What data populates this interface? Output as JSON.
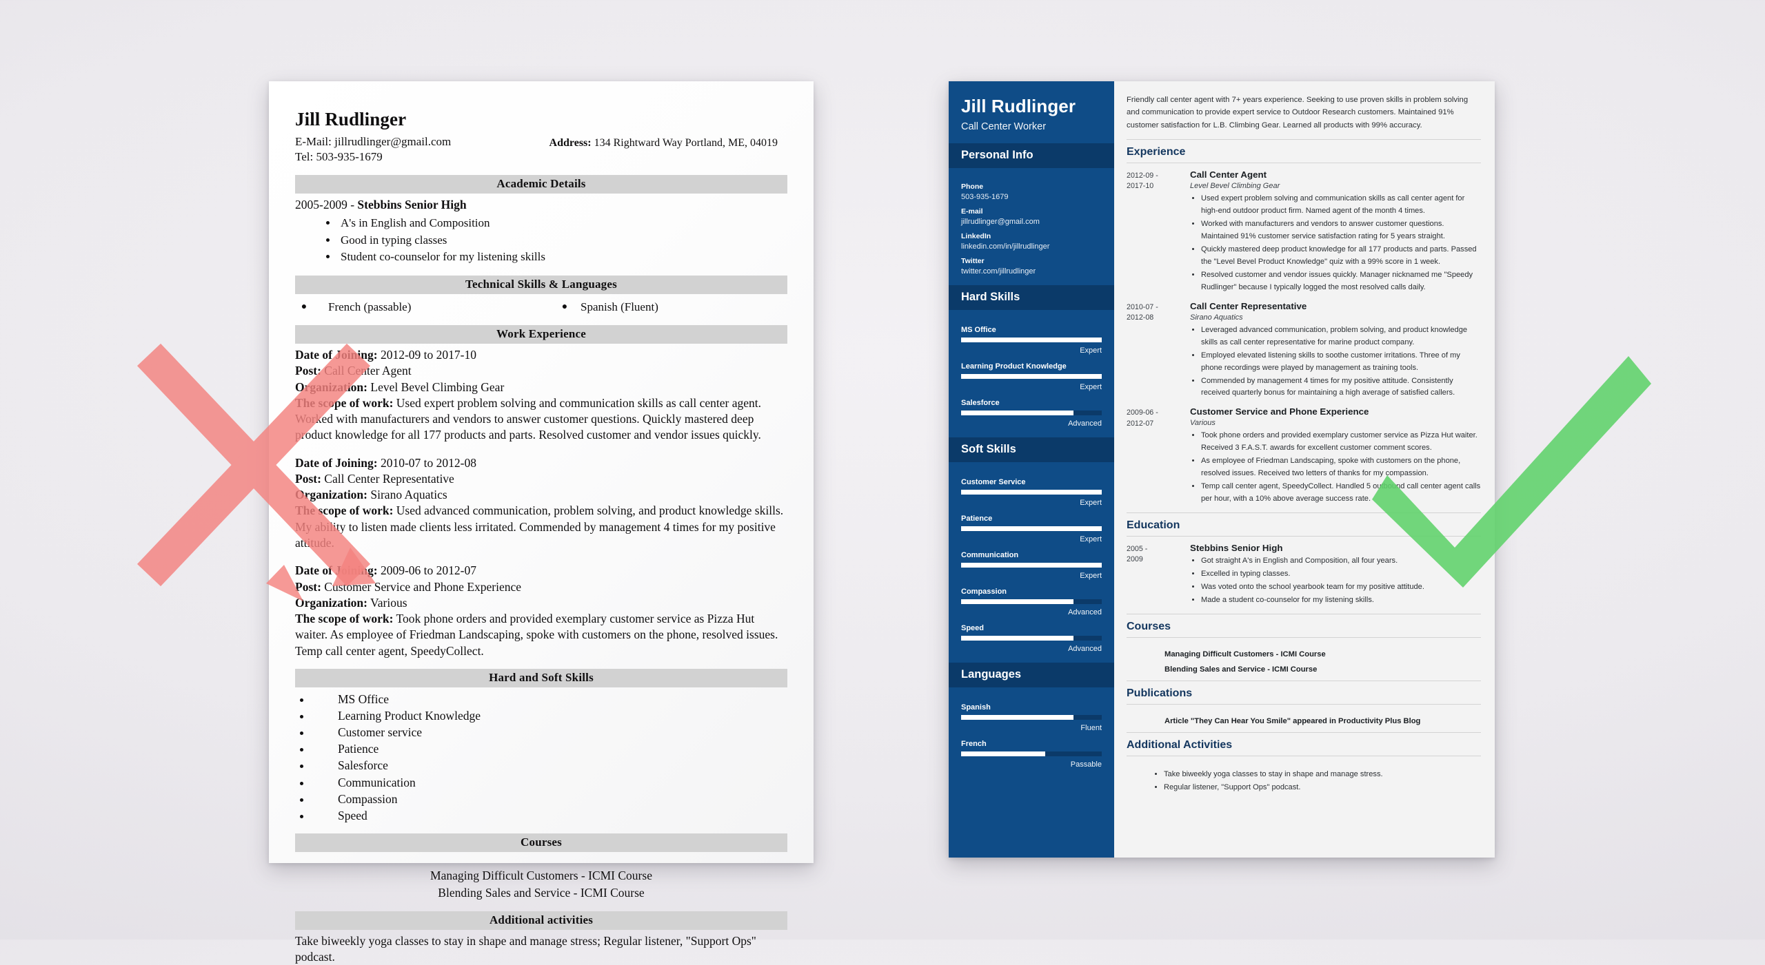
{
  "colors": {
    "sidebar_blue": "#0f4c87",
    "sidebar_blue_dark": "#0b3a69",
    "heading_blue": "#13365e",
    "bad_mark_red": "#f4827f",
    "good_mark_green": "#5ed16a",
    "bad_section_bar": "#d2d2d2"
  },
  "bad_resume": {
    "name": "Jill Rudlinger",
    "email_line": "E-Mail: jillrudlinger@gmail.com",
    "tel_line": "Tel: 503-935-1679",
    "address_label": "Address:",
    "address_value": "134 Rightward Way Portland, ME, 04019",
    "sections": {
      "academic": {
        "title": "Academic Details",
        "school_line_years": "2005-2009 - ",
        "school_line_name": "Stebbins Senior High",
        "bullets": [
          "A's in English and Composition",
          "Good in typing classes",
          "Student co-counselor for my listening skills"
        ]
      },
      "technical": {
        "title": "Technical Skills & Languages",
        "left": "French (passable)",
        "right": "Spanish (Fluent)"
      },
      "work": {
        "title": "Work Experience",
        "jobs": [
          {
            "date_label": "Date of Joining:",
            "date_value": " 2012-09 to 2017-10",
            "post_label": "Post:",
            "post_value": " Call Center Agent",
            "org_label": "Organization:",
            "org_value": " Level Bevel Climbing Gear",
            "scope_label": "The scope of work:",
            "scope_value": " Used expert problem solving and communication skills as call center agent. Worked with manufacturers and vendors to answer customer questions. Quickly mastered deep product knowledge for all 177 products and parts. Resolved customer and vendor issues quickly."
          },
          {
            "date_label": "Date of Joining:",
            "date_value": " 2010-07 to 2012-08",
            "post_label": "Post:",
            "post_value": " Call Center Representative",
            "org_label": "Organization:",
            "org_value": " Sirano Aquatics",
            "scope_label": "The scope of work:",
            "scope_value": " Used advanced communication, problem solving, and product knowledge skills. My ability to listen made clients less irritated. Commended by management 4 times for my positive attitude."
          },
          {
            "date_label": "Date of Joining:",
            "date_value": " 2009-06 to 2012-07",
            "post_label": "Post:",
            "post_value": " Customer Service and Phone Experience",
            "org_label": "Organization:",
            "org_value": " Various",
            "scope_label": "The scope of work:",
            "scope_value": " Took phone orders and provided exemplary customer service as Pizza Hut waiter. As employee of Friedman Landscaping, spoke with customers on the phone, resolved issues. Temp call center agent, SpeedyCollect."
          }
        ]
      },
      "skills": {
        "title": "Hard and Soft Skills",
        "items": [
          "MS Office",
          "Learning Product Knowledge",
          "Customer service",
          "Patience",
          "Salesforce",
          "Communication",
          "Compassion",
          "Speed"
        ]
      },
      "courses": {
        "title": "Courses",
        "items": [
          "Managing Difficult Customers - ICMI Course",
          "Blending Sales and Service - ICMI Course"
        ]
      },
      "additional": {
        "title": "Additional activities",
        "text": "Take biweekly yoga classes to stay in shape and manage stress; Regular listener, \"Support Ops\" podcast."
      }
    }
  },
  "good_resume": {
    "sidebar": {
      "name": "Jill Rudlinger",
      "role": "Call Center Worker",
      "personal_info": {
        "title": "Personal Info",
        "fields": [
          {
            "label": "Phone",
            "value": "503-935-1679"
          },
          {
            "label": "E-mail",
            "value": "jillrudlinger@gmail.com"
          },
          {
            "label": "LinkedIn",
            "value": "linkedin.com/in/jillrudlinger"
          },
          {
            "label": "Twitter",
            "value": "twitter.com/jillrudlinger"
          }
        ]
      },
      "hard_skills": {
        "title": "Hard Skills",
        "items": [
          {
            "name": "MS Office",
            "level": "Expert",
            "pct": 100
          },
          {
            "name": "Learning Product Knowledge",
            "level": "Expert",
            "pct": 100
          },
          {
            "name": "Salesforce",
            "level": "Advanced",
            "pct": 80
          }
        ]
      },
      "soft_skills": {
        "title": "Soft Skills",
        "items": [
          {
            "name": "Customer Service",
            "level": "Expert",
            "pct": 100
          },
          {
            "name": "Patience",
            "level": "Expert",
            "pct": 100
          },
          {
            "name": "Communication",
            "level": "Expert",
            "pct": 100
          },
          {
            "name": "Compassion",
            "level": "Advanced",
            "pct": 80
          },
          {
            "name": "Speed",
            "level": "Advanced",
            "pct": 80
          }
        ]
      },
      "languages": {
        "title": "Languages",
        "items": [
          {
            "name": "Spanish",
            "level": "Fluent",
            "pct": 80
          },
          {
            "name": "French",
            "level": "Passable",
            "pct": 60
          }
        ]
      }
    },
    "main": {
      "summary": "Friendly call center agent with 7+ years experience. Seeking to use proven skills in problem solving and communication to provide expert service to Outdoor Research customers. Maintained 91% customer satisfaction for L.B. Climbing Gear. Learned all products with 99% accuracy.",
      "experience": {
        "title": "Experience",
        "entries": [
          {
            "dates": "2012-09 -\n2017-10",
            "job": "Call Center Agent",
            "org": "Level Bevel Climbing Gear",
            "bullets": [
              "Used expert problem solving and communication skills as call center agent for high-end outdoor product firm. Named agent of the month 4 times.",
              "Worked with manufacturers and vendors to answer customer questions. Maintained 91% customer service satisfaction rating for 5 years straight.",
              "Quickly mastered deep product knowledge for all 177 products and parts. Passed the \"Level Bevel Product Knowledge\" quiz with a 99% score in 1 week.",
              "Resolved customer and vendor issues quickly. Manager nicknamed me \"Speedy Rudlinger\" because I typically logged the most resolved calls daily."
            ]
          },
          {
            "dates": "2010-07 -\n2012-08",
            "job": "Call Center Representative",
            "org": "Sirano Aquatics",
            "bullets": [
              "Leveraged advanced communication, problem solving, and product knowledge skills as call center representative for marine product company.",
              "Employed elevated listening skills to soothe customer irritations. Three of my phone recordings were played by management as training tools.",
              "Commended by management 4 times for my positive attitude. Consistently received quarterly bonus for maintaining a high average of satisfied callers."
            ]
          },
          {
            "dates": "2009-06 -\n2012-07",
            "job": "Customer Service and Phone Experience",
            "org": "Various",
            "bullets": [
              "Took phone orders and provided exemplary customer service as Pizza Hut waiter. Received 3 F.A.S.T. awards for excellent customer comment scores.",
              "As employee of Friedman Landscaping, spoke with customers on the phone, resolved issues. Received two letters of thanks for my compassion.",
              "Temp call center agent, SpeedyCollect. Handled 5 outbound call center agent calls per hour, with a 10% above average success rate."
            ]
          }
        ]
      },
      "education": {
        "title": "Education",
        "entries": [
          {
            "dates": "2005 -\n2009",
            "school": "Stebbins Senior High",
            "bullets": [
              "Got straight A's in English and Composition, all four years.",
              "Excelled in typing classes.",
              "Was voted onto the school yearbook team for my positive attitude.",
              "Made a student co-counselor for my listening skills."
            ]
          }
        ]
      },
      "courses": {
        "title": "Courses",
        "items": [
          "Managing Difficult Customers - ICMI Course",
          "Blending Sales and Service - ICMI Course"
        ]
      },
      "publications": {
        "title": "Publications",
        "items": [
          "Article \"They Can Hear You Smile\" appeared in Productivity Plus Blog"
        ]
      },
      "additional": {
        "title": "Additional Activities",
        "bullets": [
          "Take biweekly yoga classes to stay in shape and manage stress.",
          "Regular listener, \"Support Ops\" podcast."
        ]
      }
    }
  },
  "annotations": {
    "bad_mark": "x-mark",
    "good_mark": "check-mark"
  }
}
